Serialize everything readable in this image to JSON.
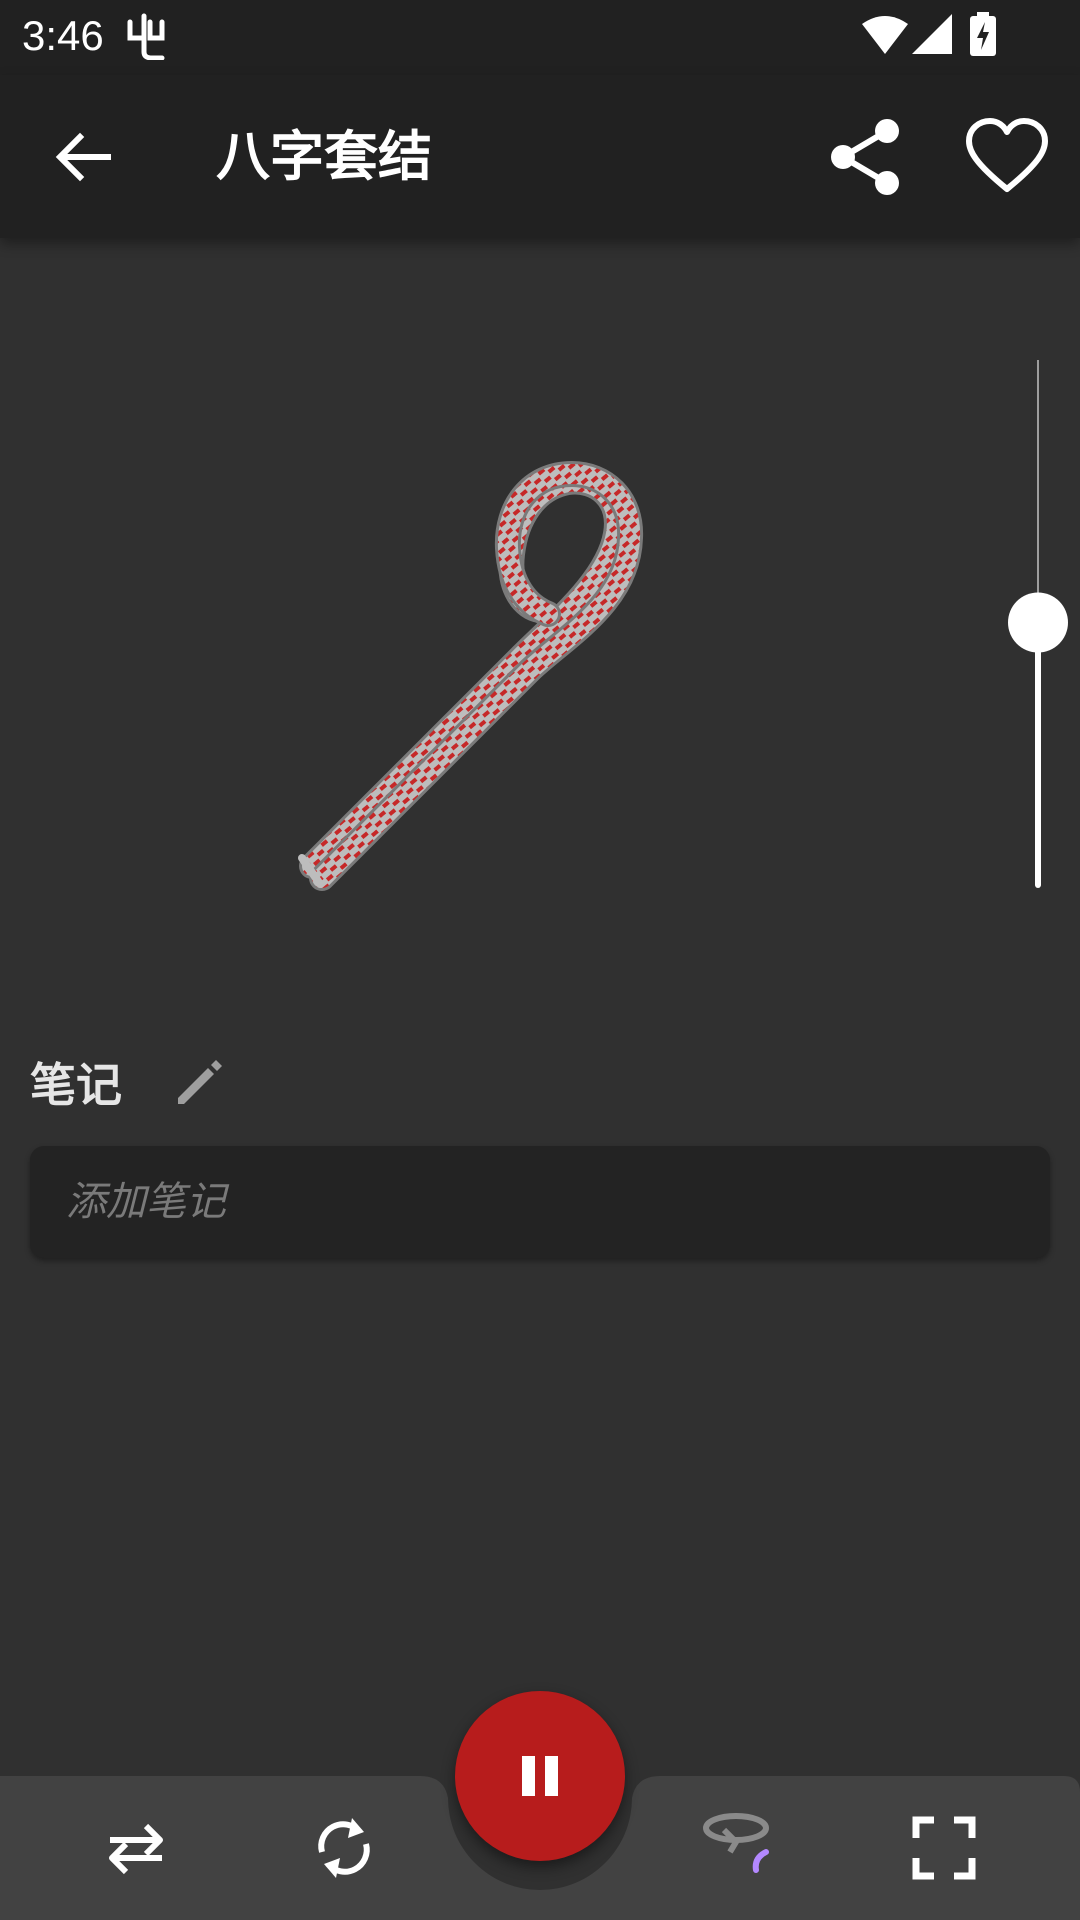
{
  "status_bar": {
    "time": "3:46",
    "icons": [
      "debug-icon",
      "wifi-icon",
      "cell-signal-icon",
      "battery-charging-icon"
    ]
  },
  "app_bar": {
    "title": "八字套结",
    "icons": [
      "arrow-back-icon",
      "share-icon",
      "heart-outline-icon"
    ]
  },
  "animation": {
    "speed_level_fraction": 0.5,
    "rope_colors": [
      "#bdbdbd",
      "#c62828"
    ]
  },
  "notes": {
    "label": "笔记",
    "placeholder": "添加笔记"
  },
  "bottom_controls": {
    "icons": [
      "swap-horiz-icon",
      "loop-icon",
      "pause-icon",
      "rotate-3d-icon",
      "fullscreen-icon"
    ],
    "play_button_color": "#b71c1c",
    "bar_color": "#424242"
  }
}
